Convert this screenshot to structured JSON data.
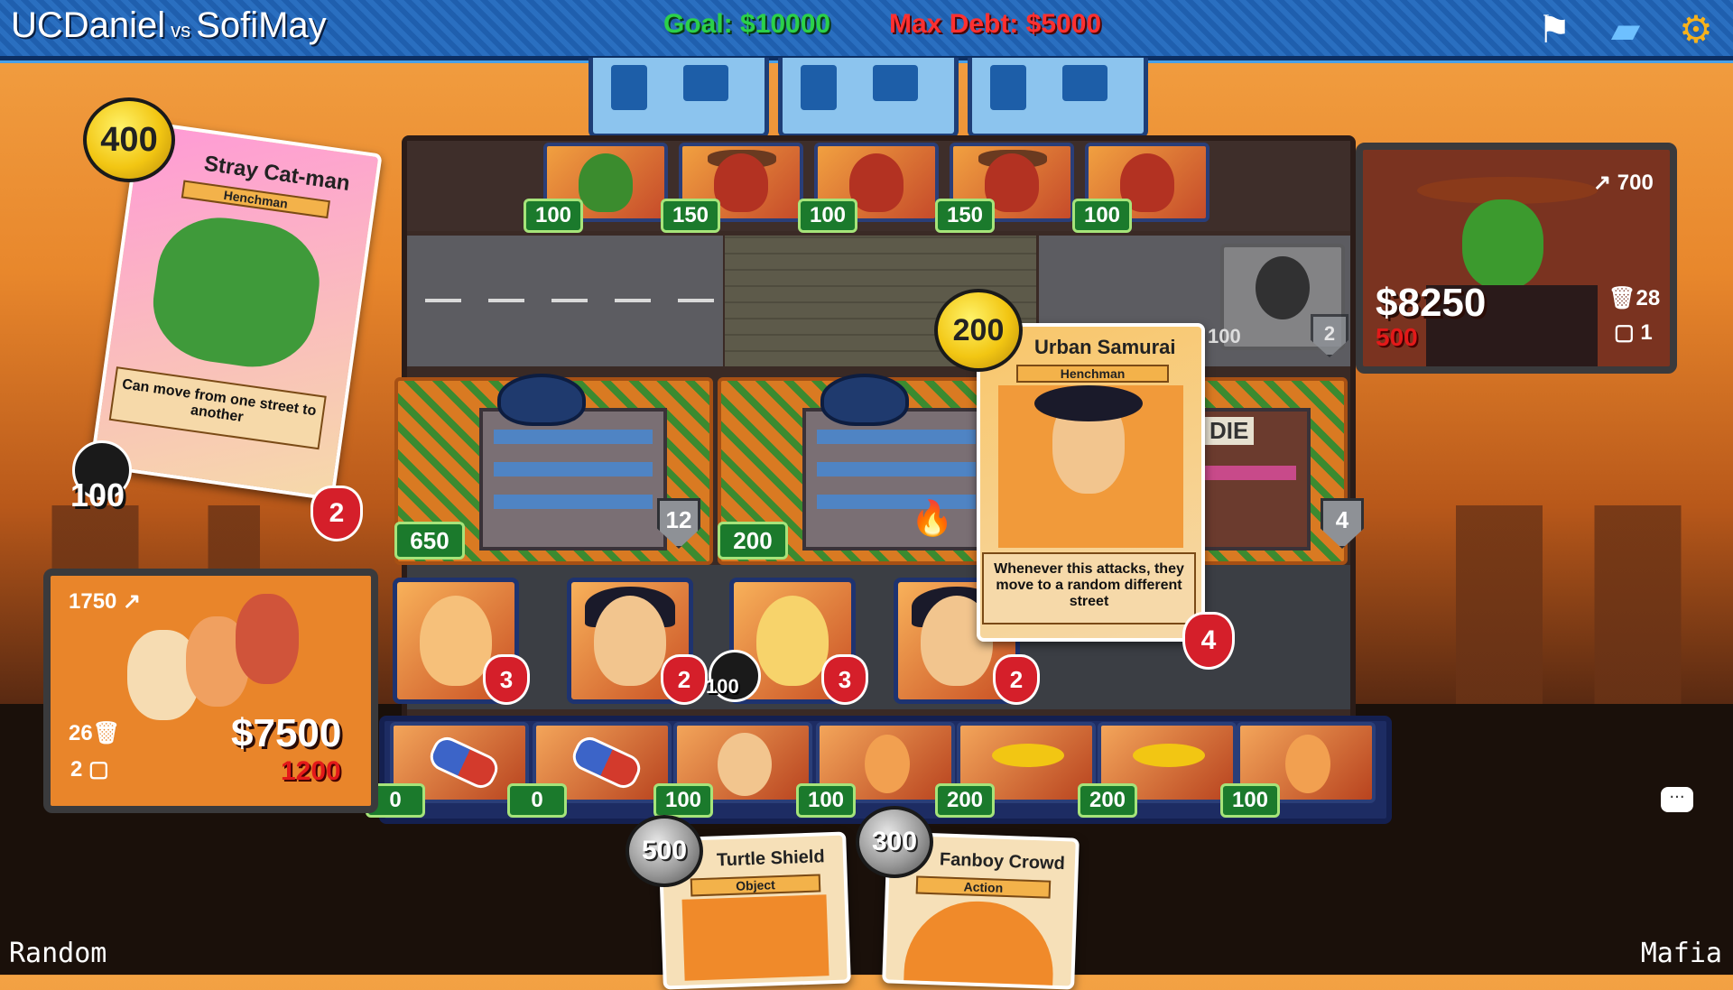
{
  "header": {
    "player1": "UCDaniel",
    "vs": "vs",
    "player2": "SofiMay",
    "goal": "Goal: $10000",
    "max_debt": "Max Debt: $5000",
    "icons": [
      "flag-icon",
      "cards-icon",
      "gear-icon"
    ]
  },
  "opponent": {
    "income": "700",
    "money": "$8250",
    "debt": "500",
    "discard_count": "28",
    "hand_count": "1"
  },
  "player": {
    "income": "1750",
    "money": "$7500",
    "debt": "1200",
    "discard_count": "26",
    "hand_count": "2"
  },
  "opponent_row": {
    "costs": [
      "100",
      "150",
      "100",
      "150",
      "100"
    ]
  },
  "buildings": [
    {
      "income": "650",
      "defense": "12"
    },
    {
      "income": "200",
      "defense": ""
    },
    {
      "income": "",
      "defense": "4",
      "sign": "DIE"
    }
  ],
  "ghost_card": {
    "cost": "100",
    "attack": "2"
  },
  "board_units": [
    {
      "attack": "3"
    },
    {
      "attack": "2"
    },
    {
      "attack": "3",
      "cost": "100"
    },
    {
      "attack": "2"
    }
  ],
  "hand_row": {
    "costs": [
      "0",
      "0",
      "100",
      "100",
      "200",
      "200",
      "100"
    ]
  },
  "stray_cat_card": {
    "cost": "400",
    "name": "Stray Cat-man",
    "type": "Henchman",
    "desc": "Can move from one street to another",
    "mask_value": "100",
    "attack": "2"
  },
  "urban_samurai_card": {
    "cost": "200",
    "name": "Urban Samurai",
    "type": "Henchman",
    "desc": "Whenever this attacks, they move to a random different street",
    "attack": "4"
  },
  "hand_cards": [
    {
      "cost": "500",
      "name": "Turtle Shield",
      "type": "Object"
    },
    {
      "cost": "300",
      "name": "Fanboy Crowd",
      "type": "Action"
    }
  ],
  "footer": {
    "left": "Random",
    "right": "Mafia"
  },
  "colors": {
    "goal": "#2bd04a",
    "debt": "#ff3030",
    "topbar": "#1f5fae",
    "cost_tag": "#1b7a2c"
  }
}
